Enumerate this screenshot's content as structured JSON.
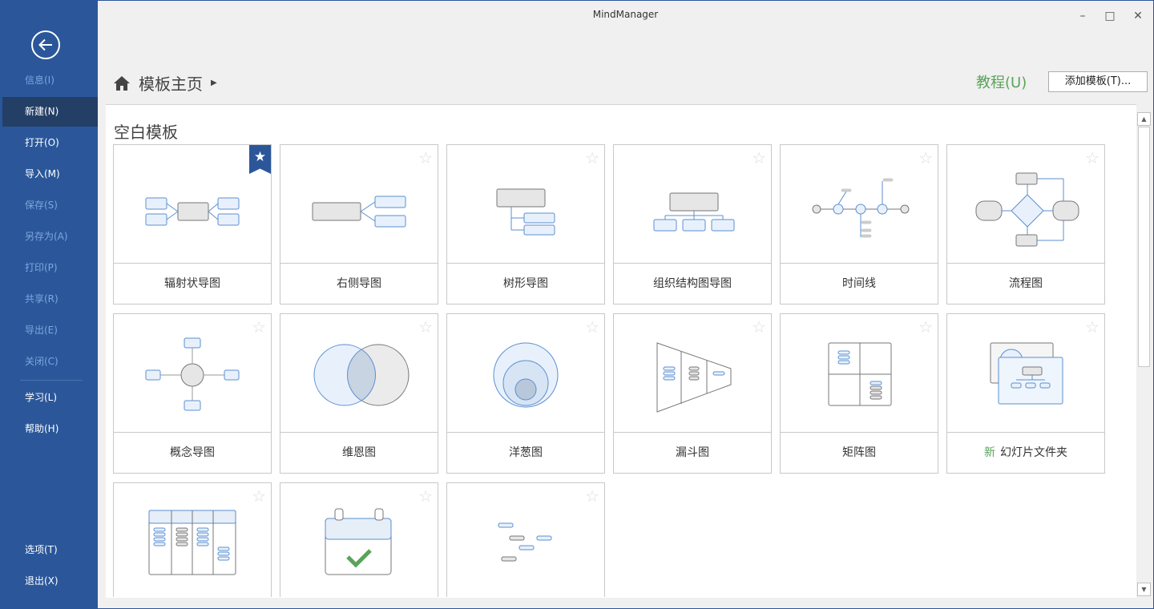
{
  "window": {
    "title": "MindManager"
  },
  "sidebar": {
    "items": [
      {
        "label": "信息(I)",
        "state": "disabled"
      },
      {
        "label": "新建(N)",
        "state": "active"
      },
      {
        "label": "打开(O)",
        "state": "normal"
      },
      {
        "label": "导入(M)",
        "state": "normal"
      },
      {
        "label": "保存(S)",
        "state": "disabled"
      },
      {
        "label": "另存为(A)",
        "state": "disabled"
      },
      {
        "label": "打印(P)",
        "state": "disabled"
      },
      {
        "label": "共享(R)",
        "state": "disabled"
      },
      {
        "label": "导出(E)",
        "state": "disabled"
      },
      {
        "label": "关闭(C)",
        "state": "disabled"
      },
      {
        "label": "学习(L)",
        "state": "normal"
      },
      {
        "label": "帮助(H)",
        "state": "normal"
      },
      {
        "label": "选项(T)",
        "state": "normal"
      },
      {
        "label": "退出(X)",
        "state": "normal"
      }
    ]
  },
  "header": {
    "breadcrumb": "模板主页",
    "tutorial": "教程(U)",
    "add_template": "添加模板(T)..."
  },
  "section": {
    "title": "空白模板"
  },
  "templates": [
    {
      "label": "辐射状导图",
      "favorite": true
    },
    {
      "label": "右侧导图"
    },
    {
      "label": "树形导图"
    },
    {
      "label": "组织结构图导图"
    },
    {
      "label": "时间线"
    },
    {
      "label": "流程图"
    },
    {
      "label": "概念导图"
    },
    {
      "label": "维恩图"
    },
    {
      "label": "洋葱图"
    },
    {
      "label": "漏斗图"
    },
    {
      "label": "矩阵图"
    },
    {
      "label": "幻灯片文件夹",
      "badge": "新"
    },
    {
      "label": ""
    },
    {
      "label": ""
    },
    {
      "label": ""
    }
  ],
  "colors": {
    "sidebar": "#2b579a",
    "accent_green": "#5aa35a",
    "node_blue": "#5b8fd0"
  }
}
